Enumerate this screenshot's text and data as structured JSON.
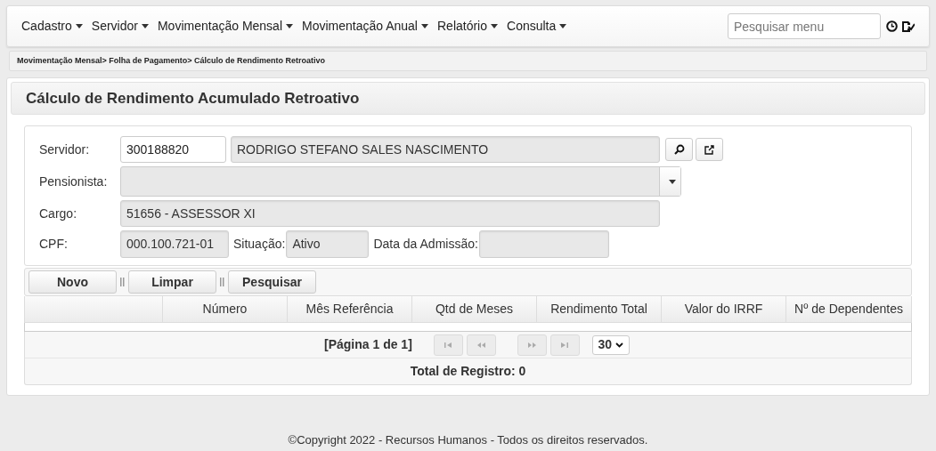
{
  "menu": [
    {
      "label": "Cadastro"
    },
    {
      "label": "Servidor"
    },
    {
      "label": "Movimentação Mensal"
    },
    {
      "label": "Movimentação Anual"
    },
    {
      "label": "Relatório"
    },
    {
      "label": "Consulta"
    }
  ],
  "menu_search": {
    "placeholder": "Pesquisar menu"
  },
  "breadcrumb": "Movimentação Mensal> Folha de Pagamento> Cálculo de Rendimento Retroativo",
  "page_title": "Cálculo de Rendimento Acumulado Retroativo",
  "form": {
    "servidor_label": "Servidor:",
    "servidor_code": "300188820",
    "servidor_name": "RODRIGO STEFANO SALES NASCIMENTO",
    "pensionista_label": "Pensionista:",
    "cargo_label": "Cargo:",
    "cargo_value": "51656 - ASSESSOR XI",
    "cpf_label": "CPF:",
    "cpf_value": "000.100.721-01",
    "situacao_label": "Situação:",
    "situacao_value": "Ativo",
    "admissao_label": "Data da Admissão:"
  },
  "toolbar": [
    "Novo",
    "Limpar",
    "Pesquisar"
  ],
  "table": {
    "columns": [
      "Número",
      "Mês Referência",
      "Qtd de Meses",
      "Rendimento Total",
      "Valor do IRRF",
      "Nº de Dependentes"
    ]
  },
  "pager": {
    "page_info": "[Página 1 de 1]",
    "disabled": true,
    "page_size": "30",
    "total": "Total de Registro: 0"
  },
  "footer": "©Copyright 2022 - Recursos Humanos - Todos os direitos reservados."
}
